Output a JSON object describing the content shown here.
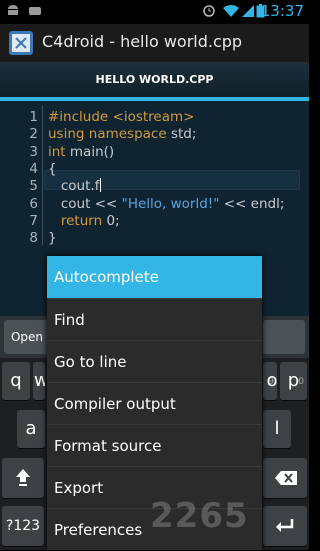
{
  "status_bar": {
    "time": "13:37",
    "icons": [
      "android-icon",
      "notification-icon",
      "alarm-icon",
      "wifi-icon",
      "signal-icon",
      "battery-icon"
    ]
  },
  "title_bar": {
    "app_icon": "c4droid-app-icon",
    "title": "C4droid - hello world.cpp"
  },
  "tab": {
    "label": "HELLO WORLD.CPP",
    "accent": "#33b5e5"
  },
  "editor": {
    "line_numbers": [
      "1",
      "2",
      "3",
      "4",
      "5",
      "6",
      "7",
      "8"
    ],
    "lines": [
      {
        "parts": [
          {
            "t": "#include <iostream>",
            "c": "kw"
          }
        ]
      },
      {
        "parts": [
          {
            "t": "using namespace",
            "c": "kw"
          },
          {
            "t": " std;",
            "c": "plain"
          }
        ]
      },
      {
        "parts": [
          {
            "t": "int",
            "c": "kw"
          },
          {
            "t": " main()",
            "c": "plain"
          }
        ]
      },
      {
        "parts": [
          {
            "t": "{",
            "c": "plain"
          }
        ]
      },
      {
        "parts": [
          {
            "t": "   cout.f",
            "c": "plain"
          }
        ]
      },
      {
        "parts": [
          {
            "t": "   cout << ",
            "c": "plain"
          },
          {
            "t": "\"Hello, world!\"",
            "c": "str"
          },
          {
            "t": " << endl;",
            "c": "plain"
          }
        ]
      },
      {
        "parts": [
          {
            "t": "   ",
            "c": "plain"
          },
          {
            "t": "return",
            "c": "kw"
          },
          {
            "t": " 0;",
            "c": "plain"
          }
        ]
      },
      {
        "parts": [
          {
            "t": "}",
            "c": "plain"
          }
        ]
      }
    ]
  },
  "toolbar": {
    "open_label": "Open"
  },
  "keyboard": {
    "keys": {
      "q": "q",
      "w": "w",
      "o": "o",
      "p": "p",
      "a": "a",
      "l": "l",
      "num_9": "9",
      "num_0": "0",
      "sym": "?123"
    }
  },
  "menu": {
    "items": [
      "Autocomplete",
      "Find",
      "Go to line",
      "Compiler output",
      "Format source",
      "Export",
      "Preferences"
    ],
    "selected_index": 0,
    "selected_color": "#33b5e5"
  },
  "watermark": "2265"
}
